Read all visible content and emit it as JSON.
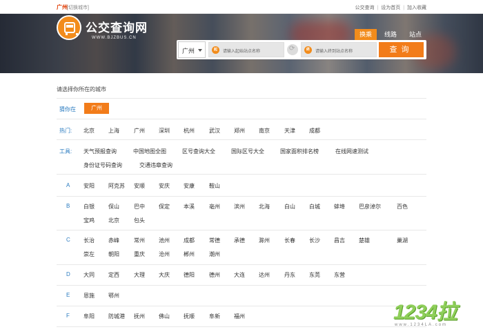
{
  "topbar": {
    "city": "广州",
    "switch": "[切换城市]",
    "links": [
      "公交查询",
      "设为首页",
      "加入收藏"
    ]
  },
  "logo": {
    "title": "公交查询网",
    "subtitle": "WWW.BJZBUS.CN"
  },
  "tabs": [
    "换乘",
    "线路",
    "站点"
  ],
  "search": {
    "city": "广州",
    "from_badge": "起",
    "from_placeholder": "请输入起始站点名称",
    "to_badge": "终",
    "to_placeholder": "请输入终到站点名称",
    "button": "查询"
  },
  "prompt": "请选择你所在的城市",
  "guess": {
    "label": "猜你在",
    "city": "广州"
  },
  "hot": {
    "label": "热门:",
    "cities": [
      "北京",
      "上海",
      "广州",
      "深圳",
      "杭州",
      "武汉",
      "郑州",
      "南京",
      "天津",
      "成都"
    ]
  },
  "tools": {
    "label": "工具:",
    "items": [
      "天气预报查询",
      "中国地图全图",
      "区号查询大全",
      "国际区号大全",
      "国家面积排名榜",
      "在线网速测试",
      "身份证号码查询",
      "交通违章查询"
    ]
  },
  "letters": [
    {
      "letter": "A",
      "cities": [
        "安阳",
        "阿克苏",
        "安顺",
        "安庆",
        "安康",
        "鞍山"
      ]
    },
    {
      "letter": "B",
      "cities": [
        "白银",
        "保山",
        "巴中",
        "保定",
        "本溪",
        "亳州",
        "滨州",
        "北海",
        "白山",
        "白城",
        "蚌埠",
        "巴彦淖尔",
        "百色",
        "宝鸡",
        "北京",
        "包头"
      ]
    },
    {
      "letter": "C",
      "cities": [
        "长治",
        "赤峰",
        "常州",
        "池州",
        "成都",
        "常德",
        "承德",
        "滁州",
        "长春",
        "长沙",
        "昌吉",
        "楚雄",
        "巢湖",
        "崇左",
        "朝阳",
        "重庆",
        "沧州",
        "郴州",
        "潮州"
      ]
    },
    {
      "letter": "D",
      "cities": [
        "大同",
        "定西",
        "大理",
        "大庆",
        "德阳",
        "德州",
        "大连",
        "达州",
        "丹东",
        "东莞",
        "东营"
      ]
    },
    {
      "letter": "E",
      "cities": [
        "恩施",
        "鄂州"
      ]
    },
    {
      "letter": "F",
      "cities": [
        "阜阳",
        "防城港",
        "抚州",
        "佛山",
        "抚顺",
        "阜新",
        "福州"
      ]
    }
  ],
  "watermark": {
    "big": "1234拉",
    "small": "www.1234LA.com"
  }
}
